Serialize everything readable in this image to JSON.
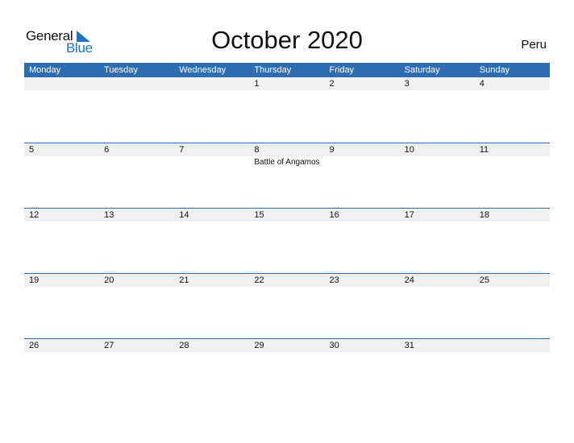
{
  "logo": {
    "general": "General",
    "blue": "Blue"
  },
  "title": "October 2020",
  "country": "Peru",
  "weekdays": [
    "Monday",
    "Tuesday",
    "Wednesday",
    "Thursday",
    "Friday",
    "Saturday",
    "Sunday"
  ],
  "weeks": [
    {
      "days": [
        "",
        "",
        "",
        "1",
        "2",
        "3",
        "4"
      ],
      "events": [
        "",
        "",
        "",
        "",
        "",
        "",
        ""
      ]
    },
    {
      "days": [
        "5",
        "6",
        "7",
        "8",
        "9",
        "10",
        "11"
      ],
      "events": [
        "",
        "",
        "",
        "Battle of Angamos",
        "",
        "",
        ""
      ]
    },
    {
      "days": [
        "12",
        "13",
        "14",
        "15",
        "16",
        "17",
        "18"
      ],
      "events": [
        "",
        "",
        "",
        "",
        "",
        "",
        ""
      ]
    },
    {
      "days": [
        "19",
        "20",
        "21",
        "22",
        "23",
        "24",
        "25"
      ],
      "events": [
        "",
        "",
        "",
        "",
        "",
        "",
        ""
      ]
    },
    {
      "days": [
        "26",
        "27",
        "28",
        "29",
        "30",
        "31",
        ""
      ],
      "events": [
        "",
        "",
        "",
        "",
        "",
        "",
        ""
      ]
    }
  ],
  "colors": {
    "accent": "#2e6db0",
    "logo_blue": "#1f75c4",
    "strip": "#f0f0f0"
  }
}
